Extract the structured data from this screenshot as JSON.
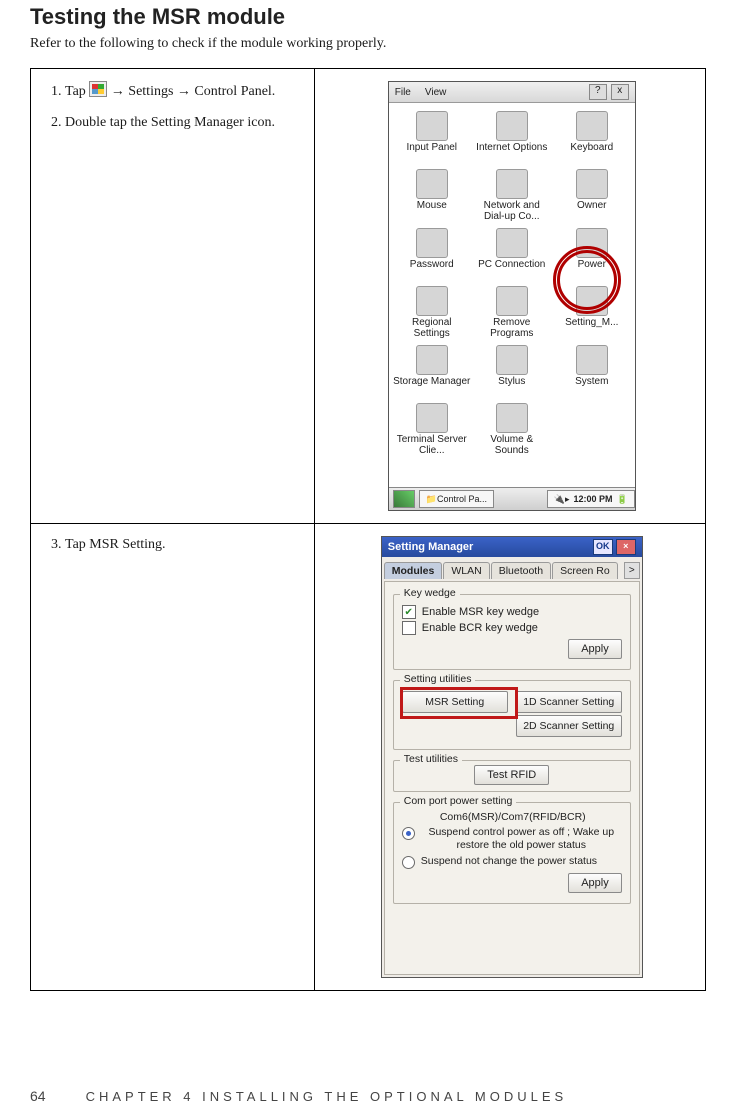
{
  "title": "Testing the MSR module",
  "intro": "Refer to the following to check if the module working properly.",
  "step1_a": "Tap ",
  "step1_b": " → Settings → Control Panel.",
  "step2": "Double tap the Setting Manager icon.",
  "step3": "Tap MSR Setting.",
  "cp": {
    "menu_file": "File",
    "menu_view": "View",
    "help_btn": "?",
    "close_btn": "x",
    "items": [
      "Input Panel",
      "Internet Options",
      "Keyboard",
      "Mouse",
      "Network and Dial-up Co...",
      "Owner",
      "Password",
      "PC Connection",
      "Power",
      "Regional Settings",
      "Remove Programs",
      "Setting_M...",
      "Storage Manager",
      "Stylus",
      "System",
      "Terminal Server Clie...",
      "Volume & Sounds",
      ""
    ],
    "task_label": "Control Pa...",
    "time": "12:00 PM",
    "tray_icon": "🔋"
  },
  "sm": {
    "title": "Setting Manager",
    "ok": "OK",
    "tabs": [
      "Modules",
      "WLAN",
      "Bluetooth",
      "Screen Ro"
    ],
    "more": ">",
    "grp_keywedge": "Key wedge",
    "chk_msr": "Enable MSR key wedge",
    "chk_bcr": "Enable BCR key wedge",
    "apply": "Apply",
    "grp_setting": "Setting utilities",
    "btn_msr": "MSR Setting",
    "btn_1d": "1D Scanner Setting",
    "btn_2d": "2D Scanner Setting",
    "grp_test": "Test utilities",
    "btn_test": "Test RFID",
    "grp_com": "Com port power setting",
    "com_sub": "Com6(MSR)/Com7(RFID/BCR)",
    "radio1": "Suspend control power as off ; Wake up restore the old power status",
    "radio2": "Suspend not change the power status"
  },
  "footer": {
    "page": "64",
    "chapter": "CHAPTER 4 INSTALLING THE OPTIONAL MODULES"
  }
}
